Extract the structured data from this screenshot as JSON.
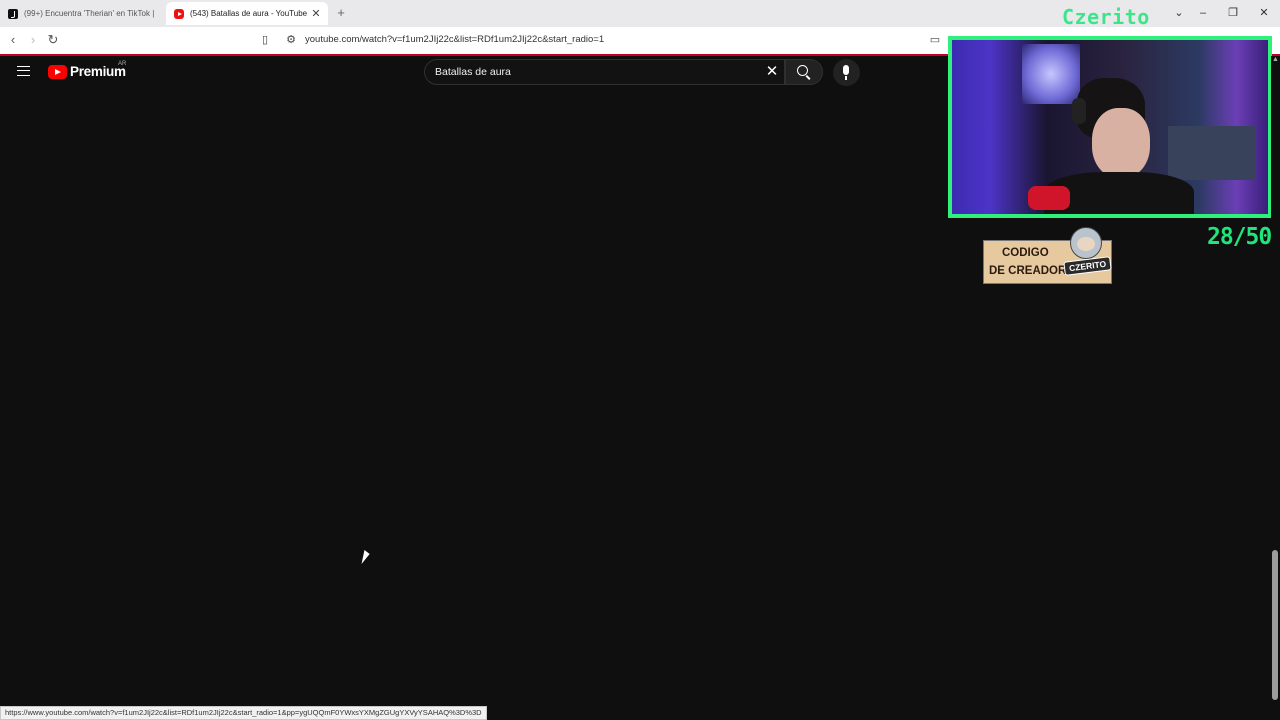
{
  "browser": {
    "tabs": [
      {
        "title": "(99+) Encuentra 'Therian' en TikTok |",
        "favicon": "tiktok-icon",
        "active": false
      },
      {
        "title": "(543) Batallas de aura - YouTube",
        "favicon": "youtube-icon",
        "active": true
      }
    ],
    "new_tab": "+",
    "url": "youtube.com/watch?v=f1um2JIj22c&list=RDf1um2JIj22c&start_radio=1",
    "window_controls": {
      "minimize": "–",
      "restore": "❐",
      "close": "✕",
      "tabs_menu": "⌄"
    }
  },
  "youtube": {
    "logo_text": "Premium",
    "region": "AR",
    "search_value": "Batallas de aura",
    "clear_icon": "✕"
  },
  "overlay": {
    "streamer_name": "Czerito",
    "counter": "28/50",
    "creator_code_line1": "CODIGO",
    "creator_code_line2": "DE CREADOR",
    "creator_tag": "CZERITO"
  },
  "status_bar": {
    "link": "https://www.youtube.com/watch?v=f1um2JIj22c&list=RDf1um2JIj22c&start_radio=1&pp=ygUQQmF0YWxsYXMgZGUgYXVyYSAHAQ%3D%3D"
  },
  "colors": {
    "page_background": "#0f0f0f",
    "overlay_green": "#1fe57a",
    "youtube_red": "#ff0000",
    "toolbar_accent": "#c4002a"
  }
}
